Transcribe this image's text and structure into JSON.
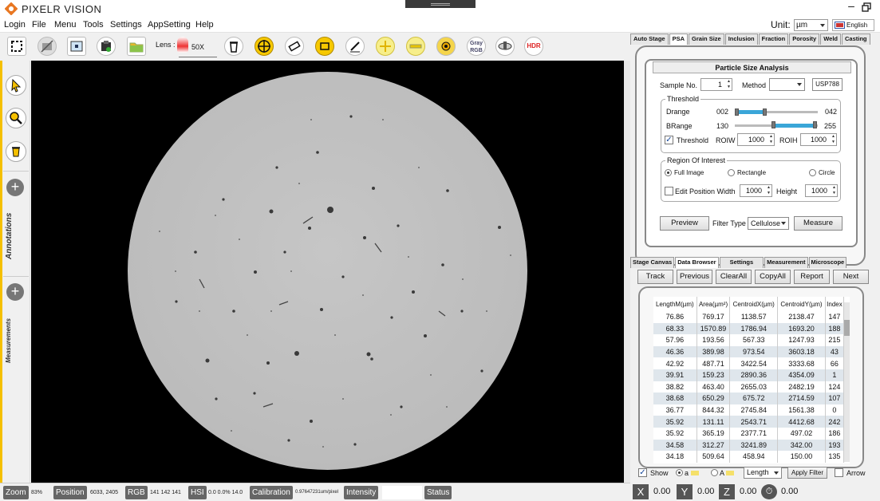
{
  "app": {
    "title": "PIXELR VISION"
  },
  "menu": {
    "items": [
      "Login",
      "File",
      "Menu",
      "Tools",
      "Settings",
      "AppSetting",
      "Help"
    ]
  },
  "unit": {
    "label": "Unit:",
    "value": "µm",
    "language": "English"
  },
  "toolbar": {
    "lens_label": "Lens :",
    "lens_value": "50X",
    "gray_rgb": "Gray RGB",
    "hdr": "HDR"
  },
  "sidebar": {
    "annotations": "Annotations",
    "measurements": "Measurements"
  },
  "tabs_top": [
    "Auto Stage",
    "PSA",
    "Grain Size",
    "Inclusion",
    "Fraction",
    "Porosity",
    "Weld",
    "Casting"
  ],
  "psa": {
    "title": "Particle Size Analysis",
    "sample_label": "Sample No.",
    "sample_value": "1",
    "method_label": "Method",
    "method_value": "",
    "standard": "USP788",
    "threshold_group": "Threshold",
    "drange_label": "Drange",
    "drange_min": "002",
    "drange_max": "042",
    "brange_label": "BRange",
    "brange_min": "130",
    "brange_max": "255",
    "threshold_check": "Threshold",
    "roiw_label": "ROIW",
    "roiw_value": "1000",
    "roih_label": "ROIH",
    "roih_value": "1000",
    "roi_group": "Region Of Interest",
    "full_image": "Full Image",
    "rectangle": "Rectangle",
    "circle": "Circle",
    "edit_position": "Edit Position Width",
    "width_value": "1000",
    "height_label": "Height",
    "height_value": "1000",
    "preview": "Preview",
    "filter_type_label": "Filter Type",
    "filter_type_value": "Cellulose",
    "measure": "Measure"
  },
  "tabs_bottom": [
    "Stage Canvas",
    "Data Browser",
    "Settings",
    "Measurement",
    "Microscope"
  ],
  "nav": [
    "Track",
    "Previous",
    "ClearAll",
    "CopyAll",
    "Report",
    "Next"
  ],
  "table": {
    "headers": [
      "LengthM(µm)",
      "Area(µm²)",
      "CentroidX(µm)",
      "CentroidY(µm)",
      "Index"
    ],
    "rows": [
      [
        "76.86",
        "769.17",
        "1138.57",
        "2138.47",
        "147"
      ],
      [
        "68.33",
        "1570.89",
        "1786.94",
        "1693.20",
        "188"
      ],
      [
        "57.96",
        "193.56",
        "567.33",
        "1247.93",
        "215"
      ],
      [
        "46.36",
        "389.98",
        "973.54",
        "3603.18",
        "43"
      ],
      [
        "42.92",
        "487.71",
        "3422.54",
        "3333.68",
        "66"
      ],
      [
        "39.91",
        "159.23",
        "2890.36",
        "4354.09",
        "1"
      ],
      [
        "38.82",
        "463.40",
        "2655.03",
        "2482.19",
        "124"
      ],
      [
        "38.68",
        "650.29",
        "675.72",
        "2714.59",
        "107"
      ],
      [
        "36.77",
        "844.32",
        "2745.84",
        "1561.38",
        "0"
      ],
      [
        "35.92",
        "131.11",
        "2543.71",
        "4412.68",
        "242"
      ],
      [
        "35.92",
        "365.19",
        "2377.71",
        "497.02",
        "186"
      ],
      [
        "34.58",
        "312.27",
        "3241.89",
        "342.00",
        "193"
      ],
      [
        "34.18",
        "509.64",
        "458.94",
        "150.00",
        "135"
      ]
    ]
  },
  "filter": {
    "show": "Show",
    "a_small": "a",
    "a_big": "A",
    "select": "Length",
    "apply": "Apply Filter",
    "arrow": "Arrow"
  },
  "status": {
    "zoom_label": "Zoom",
    "zoom_value": "83%",
    "position_label": "Position",
    "position_value": "6033, 2405",
    "rgb_label": "RGB",
    "rgb_value": "141 142 141",
    "hsi_label": "HSI",
    "hsi_value": "0.0 0.0% 14.0",
    "calibration_label": "Calibration",
    "calibration_value": "0.97647231um/pixel",
    "intensity_label": "Intensity",
    "status_label": "Status"
  },
  "coords": {
    "x_label": "X",
    "x": "0.00",
    "y_label": "Y",
    "y": "0.00",
    "z_label": "Z",
    "z": "0.00",
    "t": "0.00"
  },
  "colors": {
    "accent": "#f5c000",
    "slider": "#3aa6d8",
    "row_alt": "#dfe6ec",
    "viewer_bg": "#000000"
  }
}
